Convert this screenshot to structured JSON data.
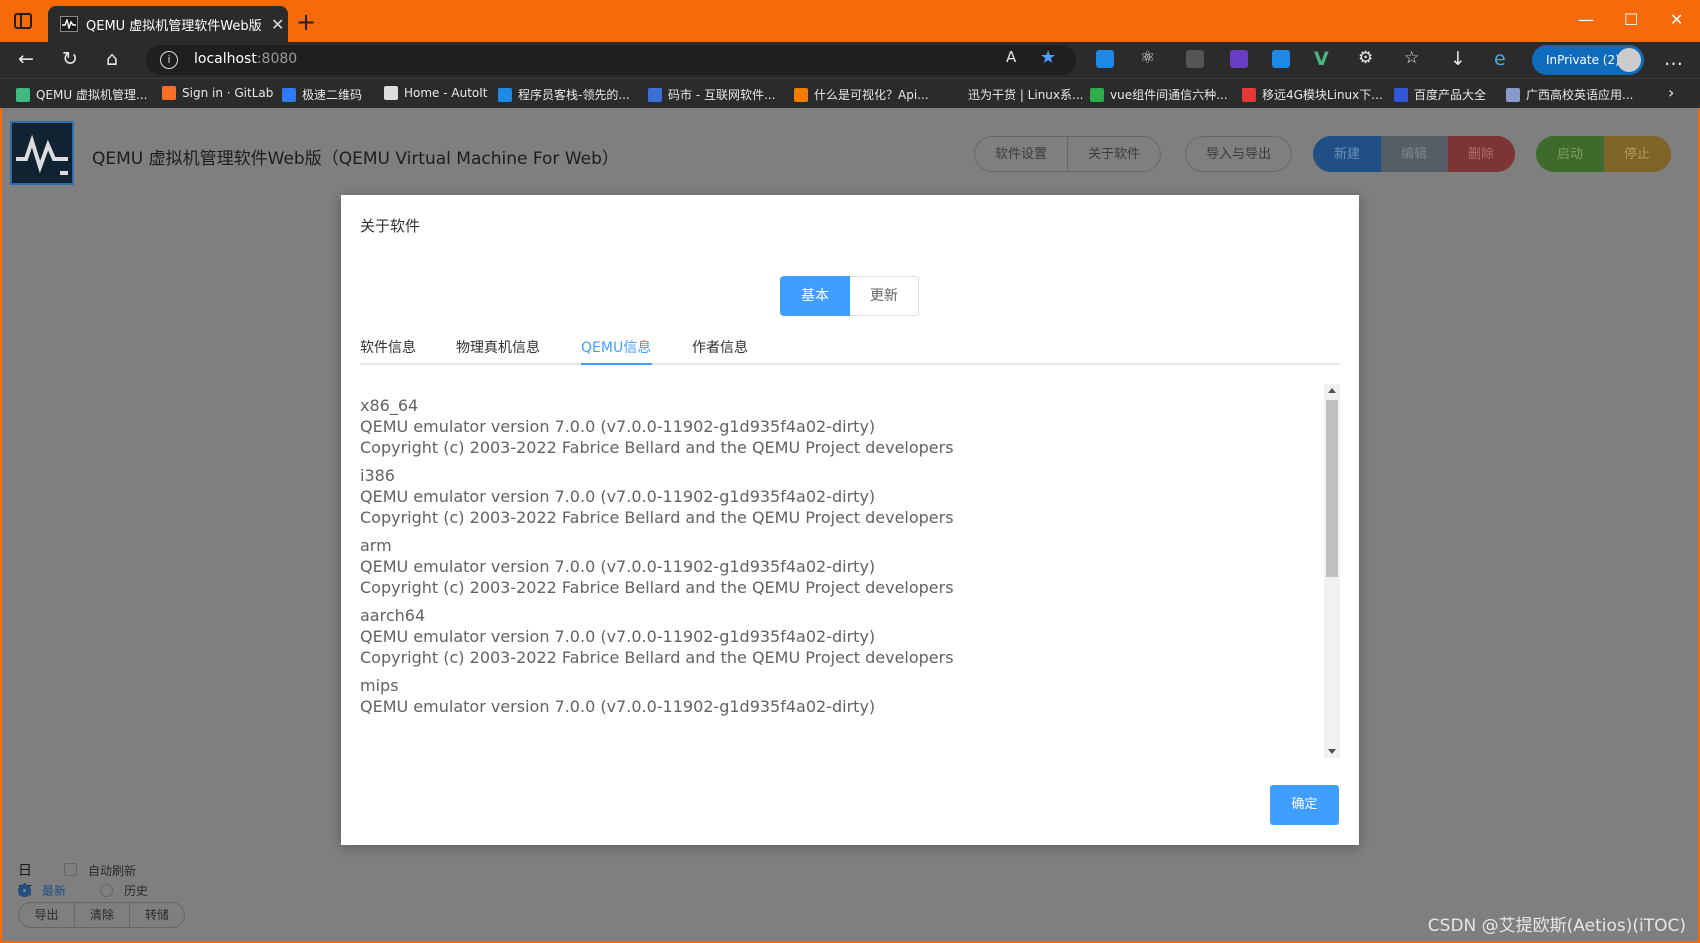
{
  "browser": {
    "tab_title": "QEMU 虚拟机管理软件Web版（(",
    "url_host": "localhost",
    "url_port": ":8080",
    "inprivate_label": "InPrivate (2)",
    "bookmarks": [
      {
        "label": "QEMU 虚拟机管理...",
        "color": "#42b883"
      },
      {
        "label": "Sign in · GitLab",
        "color": "#fc6d26"
      },
      {
        "label": "极速二维码",
        "color": "#2f7bf5"
      },
      {
        "label": "Home - AutoIt",
        "color": "#dddddd"
      },
      {
        "label": "程序员客栈-领先的...",
        "color": "#1e88e5"
      },
      {
        "label": "码市 - 互联网软件...",
        "color": "#3b6fd6"
      },
      {
        "label": "什么是可视化？Api...",
        "color": "#f57c00"
      },
      {
        "label": "迅为干货 | Linux系...",
        "color": "#2b2b2b"
      },
      {
        "label": "vue组件间通信六种...",
        "color": "#2eae4b"
      },
      {
        "label": "移远4G模块Linux下...",
        "color": "#e53935"
      },
      {
        "label": "百度产品大全",
        "color": "#3157d5"
      },
      {
        "label": "广西高校英语应用...",
        "color": "#8899cc"
      }
    ]
  },
  "app": {
    "title": "QEMU 虚拟机管理软件Web版（QEMU Virtual Machine For Web）",
    "buttons": {
      "settings": "软件设置",
      "about": "关于软件",
      "import_export": "导入与导出",
      "new": "新建",
      "edit": "编辑",
      "delete": "删除",
      "start": "启动",
      "stop": "停止"
    }
  },
  "log": {
    "title": "日志",
    "auto_refresh": "自动刷新",
    "latest": "最新",
    "history": "历史",
    "export": "导出",
    "clear": "清除",
    "dump": "转储"
  },
  "dialog": {
    "title": "关于软件",
    "segments": {
      "basic": "基本",
      "update": "更新"
    },
    "tabs": {
      "software": "软件信息",
      "host": "物理真机信息",
      "qemu": "QEMU信息",
      "author": "作者信息"
    },
    "entries": [
      {
        "arch": "x86_64",
        "version": "QEMU emulator version 7.0.0 (v7.0.0-11902-g1d935f4a02-dirty)",
        "copyright": "Copyright (c) 2003-2022 Fabrice Bellard and the QEMU Project developers"
      },
      {
        "arch": "i386",
        "version": "QEMU emulator version 7.0.0 (v7.0.0-11902-g1d935f4a02-dirty)",
        "copyright": "Copyright (c) 2003-2022 Fabrice Bellard and the QEMU Project developers"
      },
      {
        "arch": "arm",
        "version": "QEMU emulator version 7.0.0 (v7.0.0-11902-g1d935f4a02-dirty)",
        "copyright": "Copyright (c) 2003-2022 Fabrice Bellard and the QEMU Project developers"
      },
      {
        "arch": "aarch64",
        "version": "QEMU emulator version 7.0.0 (v7.0.0-11902-g1d935f4a02-dirty)",
        "copyright": "Copyright (c) 2003-2022 Fabrice Bellard and the QEMU Project developers"
      },
      {
        "arch": "mips",
        "version": "QEMU emulator version 7.0.0 (v7.0.0-11902-g1d935f4a02-dirty)",
        "copyright": ""
      }
    ],
    "ok": "确定"
  },
  "watermark": "CSDN @艾提欧斯(Aetios)(iTOC)",
  "colors": {
    "accent": "#409eff",
    "browser_frame": "#f66a0a"
  }
}
